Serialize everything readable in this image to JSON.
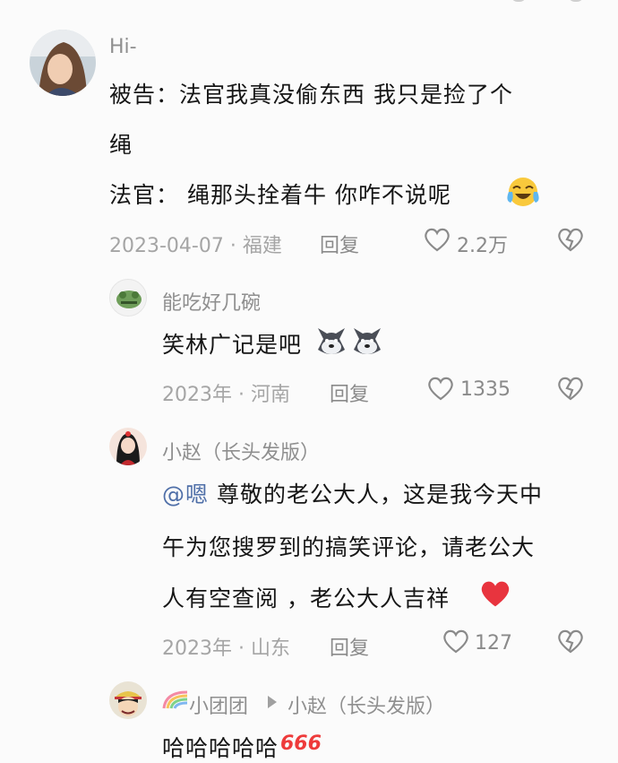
{
  "colors": {
    "name": "#8f8f8f",
    "meta": "#a5a5a5",
    "mention": "#4f6fa8",
    "text": "#161616",
    "heart": "#e8343e"
  },
  "comments": [
    {
      "user": "Hi-",
      "lines": [
        "被告：法官我真没偷东西   我只是捡了个",
        "绳",
        "法官：  绳那头拴着牛  你咋不说呢"
      ],
      "emoji": "crying-laughing-face",
      "date_loc": "2023-04-07 · 福建",
      "reply": "回复",
      "likes": "2.2万"
    },
    {
      "user": "能吃好几碗",
      "lines": [
        "笑林广记是吧"
      ],
      "emoji": "wolf-face",
      "date_loc": "2023年 · 河南",
      "reply": "回复",
      "likes": "1335"
    },
    {
      "user": "小赵（长头发版）",
      "mention": "@嗯",
      "lines": [
        " 尊敬的老公大人，这是我今天中",
        "午为您搜罗到的搞笑评论，请老公大",
        "人有空查阅 ，老公大人吉祥"
      ],
      "emoji": "red-heart",
      "date_loc": "2023年 · 山东",
      "reply": "回复",
      "likes": "127"
    },
    {
      "user": "小团团",
      "reply_to": "小赵（长头发版）",
      "lines": [
        "哈哈哈哈哈"
      ],
      "emoji_text": "666"
    }
  ]
}
